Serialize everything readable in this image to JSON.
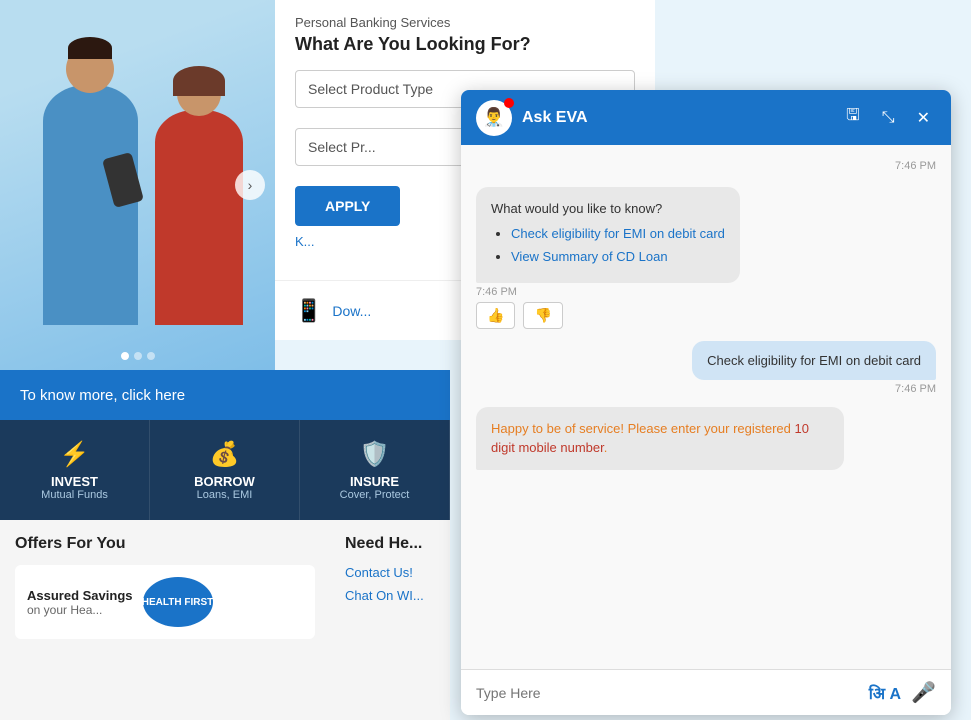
{
  "page": {
    "title": "Personal Banking",
    "background_color": "#e8f4fb"
  },
  "banking_section": {
    "subtitle": "Personal Banking Services",
    "title": "What Are You Looking For?",
    "select_product_label": "Select Product Type",
    "select_product_placeholder": "Select Product Type",
    "select_subcategory_placeholder": "Select Pr...",
    "apply_button": "APPLY",
    "know_more_link": "K...",
    "download_text": "Dow..."
  },
  "info_banner": {
    "text": "To know more, click here"
  },
  "nav_items": [
    {
      "id": "invest",
      "icon": "⬡",
      "label": "INVEST",
      "sublabel": "Mutual Funds"
    },
    {
      "id": "borrow",
      "icon": "◈",
      "label": "BORROW",
      "sublabel": "Loans, EMI"
    },
    {
      "id": "insure",
      "icon": "◉",
      "label": "INSURE",
      "sublabel": "Cover, Protect"
    }
  ],
  "offers": {
    "title": "Offers For You",
    "card": {
      "title": "Assured Savings",
      "subtitle": "on your Hea...",
      "badge_line1": "HEALTH",
      "badge_line2": "FIRST"
    }
  },
  "help": {
    "title": "Need He...",
    "contact_us": "Contact Us!",
    "chat_on_wi": "Chat On WI..."
  },
  "chat": {
    "title": "Ask EVA",
    "avatar_icon": "👨‍⚕️",
    "header_buttons": {
      "save": "🖫",
      "minimize": "⤡",
      "close": "✕"
    },
    "messages": [
      {
        "type": "timestamp",
        "value": "7:46 PM",
        "align": "right"
      },
      {
        "type": "bot",
        "text": "What would you like to know?",
        "options": [
          {
            "label": "Check eligibility for EMI on debit card",
            "link": true
          },
          {
            "label": "View Summary of CD Loan",
            "link": true
          }
        ],
        "time": "7:46 PM"
      },
      {
        "type": "user",
        "text": "Check eligibility for EMI on debit card",
        "time": "7:46 PM"
      },
      {
        "type": "bot",
        "text_parts": [
          {
            "content": "Happy to be of service! Please enter your\nregistered ",
            "color": "orange"
          },
          {
            "content": "10 digit mobile number",
            "color": "red"
          },
          {
            "content": ".",
            "color": "orange"
          }
        ]
      }
    ],
    "input_placeholder": "Type Here",
    "hindi_btn_label": "अि A",
    "mic_icon": "🎤"
  }
}
